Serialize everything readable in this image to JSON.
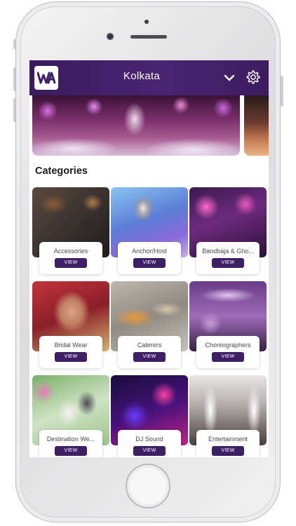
{
  "app": {
    "logo_text": "WA",
    "city": "Kolkata",
    "icons": {
      "dropdown": "chevron-down-icon",
      "settings": "gear-icon"
    },
    "colors": {
      "appbar": "#3a1a5c",
      "accent": "#3e1f66"
    }
  },
  "section_title": "Categories",
  "categories": [
    {
      "name": "Accessories",
      "view": "VIEW"
    },
    {
      "name": "Anchor/Host",
      "view": "VIEW"
    },
    {
      "name": "Bandbaja & Gho...",
      "view": "VIEW"
    },
    {
      "name": "Bridal Wear",
      "view": "VIEW"
    },
    {
      "name": "Caterers",
      "view": "VIEW"
    },
    {
      "name": "Choreographers",
      "view": "VIEW"
    },
    {
      "name": "Destination We...",
      "view": "VIEW"
    },
    {
      "name": "DJ Sound",
      "view": "VIEW"
    },
    {
      "name": "Entertainment",
      "view": "VIEW"
    }
  ]
}
